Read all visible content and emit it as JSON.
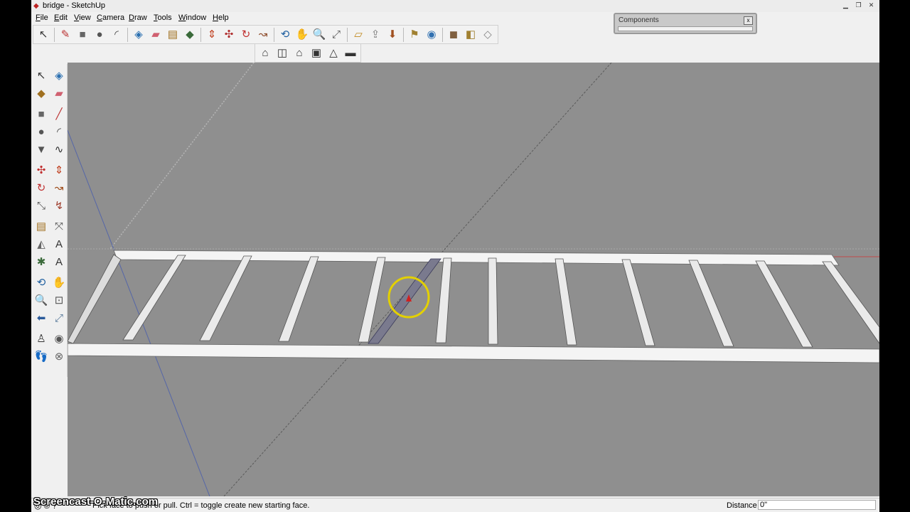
{
  "window": {
    "title": "bridge - SketchUp",
    "app_icon": "sketchup-logo-icon",
    "controls": [
      "minimize-icon",
      "restore-icon",
      "close-icon"
    ]
  },
  "menu": [
    "File",
    "Edit",
    "View",
    "Camera",
    "Draw",
    "Tools",
    "Window",
    "Help"
  ],
  "toolbar_main": [
    {
      "name": "select-tool",
      "glyph": "↖"
    },
    {
      "name": "pencil-line-tool",
      "glyph": "✎"
    },
    {
      "name": "rectangle-tool",
      "glyph": "■"
    },
    {
      "name": "circle-tool",
      "glyph": "●"
    },
    {
      "name": "arc-tool",
      "glyph": "◜"
    },
    {
      "name": "make-component-tool",
      "glyph": "◈"
    },
    {
      "name": "eraser-tool",
      "glyph": "▰"
    },
    {
      "name": "tape-measure-tool",
      "glyph": "▤"
    },
    {
      "name": "paint-bucket-tool",
      "glyph": "◆"
    },
    {
      "name": "push-pull-tool",
      "glyph": "⇕"
    },
    {
      "name": "move-tool",
      "glyph": "✣"
    },
    {
      "name": "rotate-tool",
      "glyph": "↻"
    },
    {
      "name": "follow-me-tool",
      "glyph": "↝"
    },
    {
      "name": "orbit-tool",
      "glyph": "⟲"
    },
    {
      "name": "pan-tool",
      "glyph": "✋"
    },
    {
      "name": "zoom-tool",
      "glyph": "🔍"
    },
    {
      "name": "zoom-extents-tool",
      "glyph": "⤢"
    },
    {
      "name": "3d-warehouse-get-models",
      "glyph": "▱"
    },
    {
      "name": "3d-warehouse-share-model",
      "glyph": "⇪"
    },
    {
      "name": "place-model-tool",
      "glyph": "⬇"
    },
    {
      "name": "get-current-view-tool",
      "glyph": "⚑"
    },
    {
      "name": "google-earth-toggle",
      "glyph": "◉"
    },
    {
      "name": "component-library-tool",
      "glyph": "◼"
    },
    {
      "name": "extension-warehouse-tool",
      "glyph": "◧"
    },
    {
      "name": "share-component-tool",
      "glyph": "◇"
    }
  ],
  "toolbar_views": [
    {
      "name": "iso-view",
      "glyph": "⌂"
    },
    {
      "name": "top-view",
      "glyph": "◫"
    },
    {
      "name": "front-view",
      "glyph": "⌂"
    },
    {
      "name": "right-view",
      "glyph": "▣"
    },
    {
      "name": "back-view",
      "glyph": "△"
    },
    {
      "name": "left-view",
      "glyph": "▬"
    }
  ],
  "left_toolbar": [
    {
      "name": "select-tool",
      "glyph": "↖"
    },
    {
      "name": "make-component-tool",
      "glyph": "◈"
    },
    {
      "name": "paint-bucket-tool",
      "glyph": "◆"
    },
    {
      "name": "eraser-tool",
      "glyph": "▰"
    },
    {
      "name": "rectangle-tool",
      "glyph": "■"
    },
    {
      "name": "line-tool",
      "glyph": "╱"
    },
    {
      "name": "circle-tool",
      "glyph": "●"
    },
    {
      "name": "arc-tool",
      "glyph": "◜"
    },
    {
      "name": "polygon-tool",
      "glyph": "▼"
    },
    {
      "name": "freehand-tool",
      "glyph": "∿"
    },
    {
      "name": "move-tool",
      "glyph": "✣"
    },
    {
      "name": "push-pull-tool",
      "glyph": "⇕"
    },
    {
      "name": "rotate-tool",
      "glyph": "↻"
    },
    {
      "name": "follow-me-tool",
      "glyph": "↝"
    },
    {
      "name": "scale-tool",
      "glyph": "⤡"
    },
    {
      "name": "offset-tool",
      "glyph": "↯"
    },
    {
      "name": "tape-measure-tool",
      "glyph": "▤"
    },
    {
      "name": "dimension-tool",
      "glyph": "⤧"
    },
    {
      "name": "protractor-tool",
      "glyph": "◭"
    },
    {
      "name": "text-tool",
      "glyph": "A"
    },
    {
      "name": "axes-tool",
      "glyph": "✱"
    },
    {
      "name": "3d-text-tool",
      "glyph": "A"
    },
    {
      "name": "orbit-tool",
      "glyph": "⟲"
    },
    {
      "name": "pan-tool",
      "glyph": "✋"
    },
    {
      "name": "zoom-tool",
      "glyph": "🔍"
    },
    {
      "name": "zoom-window-tool",
      "glyph": "⊡"
    },
    {
      "name": "previous-view-tool",
      "glyph": "⬅"
    },
    {
      "name": "zoom-extents-tool",
      "glyph": "⤢"
    },
    {
      "name": "position-camera-tool",
      "glyph": "♙"
    },
    {
      "name": "look-around-tool",
      "glyph": "◉"
    },
    {
      "name": "walk-tool",
      "glyph": "👣"
    },
    {
      "name": "section-plane-tool",
      "glyph": "⊗"
    }
  ],
  "viewport": {
    "background_color": "#8f8f8f",
    "cursor": "push-pull-inference-circle"
  },
  "status": {
    "hint": "Pick face to push or pull.  Ctrl = toggle create new starting face.",
    "vcb_label": "Distance",
    "vcb_value": "0\"",
    "icons": [
      "geo-location-icon",
      "credits-icon",
      "help-icon"
    ]
  },
  "components_panel": {
    "title": "Components"
  },
  "watermark": "Screencast-O-Matic.com"
}
